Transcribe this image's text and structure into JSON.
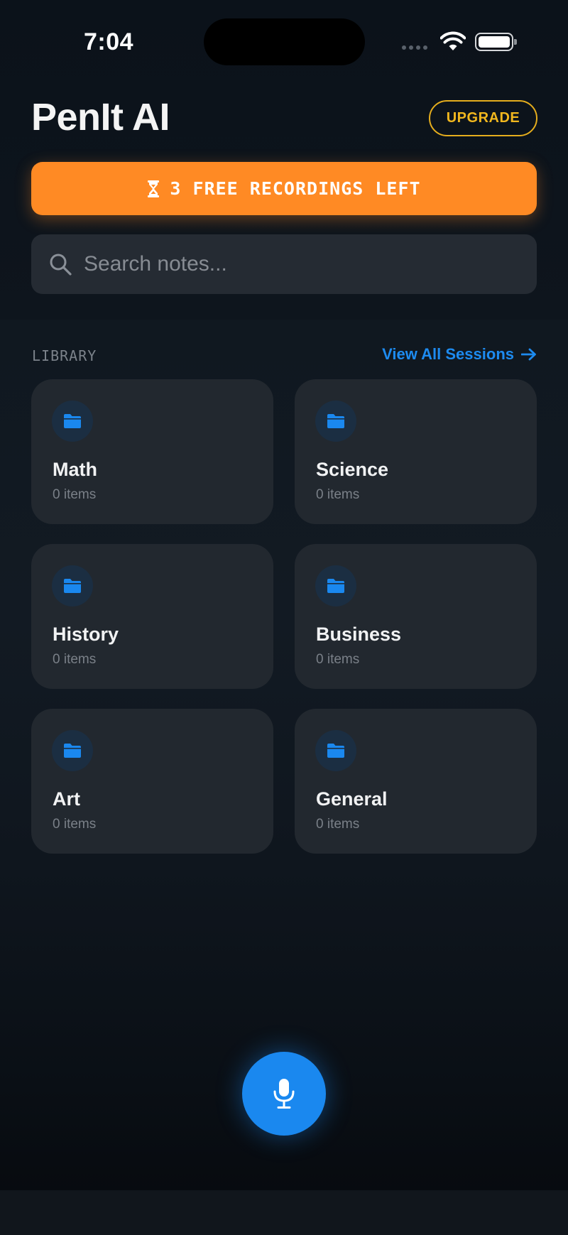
{
  "status_bar": {
    "time": "7:04",
    "icons": [
      "cellular-signal-icon",
      "wifi-icon",
      "battery-icon"
    ]
  },
  "header": {
    "title": "PenIt AI",
    "upgrade_label": "UPGRADE"
  },
  "banner": {
    "icon": "hourglass-icon",
    "text": "3 FREE RECORDINGS LEFT"
  },
  "search": {
    "placeholder": "Search notes...",
    "value": ""
  },
  "library": {
    "section_label": "LIBRARY",
    "view_all_label": "View All Sessions",
    "folders": [
      {
        "name": "Math",
        "count": "0 items"
      },
      {
        "name": "Science",
        "count": "0 items"
      },
      {
        "name": "History",
        "count": "0 items"
      },
      {
        "name": "Business",
        "count": "0 items"
      },
      {
        "name": "Art",
        "count": "0 items"
      },
      {
        "name": "General",
        "count": "0 items"
      }
    ]
  },
  "record": {
    "icon": "microphone-icon"
  },
  "colors": {
    "background": "#0f151d",
    "accent_orange": "#ff8a24",
    "accent_blue": "#1a88ef",
    "upgrade_gold": "#f1b71e",
    "card": "#22282f"
  }
}
